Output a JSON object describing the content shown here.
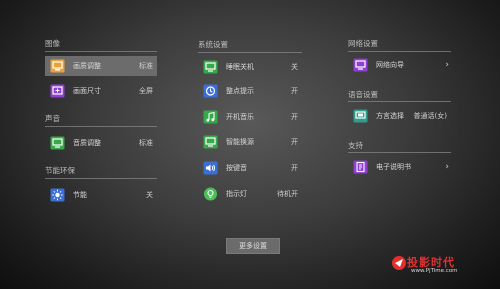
{
  "columns": {
    "left": {
      "picture": {
        "title": "图像",
        "items": [
          {
            "label": "画质调整",
            "value": "标准",
            "icon": "picture-adjust-icon",
            "selected": true
          },
          {
            "label": "画面尺寸",
            "value": "全屏",
            "icon": "screen-size-icon"
          }
        ]
      },
      "sound": {
        "title": "声音",
        "items": [
          {
            "label": "音质调整",
            "value": "标准",
            "icon": "sound-quality-icon"
          }
        ]
      },
      "eco": {
        "title": "节能环保",
        "items": [
          {
            "label": "节能",
            "value": "关",
            "icon": "energy-saving-icon"
          }
        ]
      }
    },
    "middle": {
      "system": {
        "title": "系统设置",
        "items": [
          {
            "label": "睡眠关机",
            "value": "关",
            "icon": "sleep-shutdown-icon"
          },
          {
            "label": "整点提示",
            "value": "开",
            "icon": "hourly-reminder-icon"
          },
          {
            "label": "开机音乐",
            "value": "开",
            "icon": "boot-music-icon"
          },
          {
            "label": "智能换源",
            "value": "开",
            "icon": "smart-source-icon"
          },
          {
            "label": "按键音",
            "value": "开",
            "icon": "key-sound-icon"
          },
          {
            "label": "指示灯",
            "value": "待机开",
            "icon": "indicator-light-icon"
          }
        ]
      }
    },
    "right": {
      "network": {
        "title": "网络设置",
        "items": [
          {
            "label": "网络向导",
            "icon": "network-wizard-icon"
          }
        ]
      },
      "voice": {
        "title": "语音设置",
        "items": [
          {
            "label": "方言选择",
            "value": "普通话(女)",
            "icon": "dialect-icon"
          }
        ]
      },
      "support": {
        "title": "支持",
        "items": [
          {
            "label": "电子说明书",
            "icon": "e-manual-icon"
          }
        ]
      }
    }
  },
  "more_settings": "更多设置",
  "watermark": {
    "title": "投影时代",
    "url": "www.PjTime.com"
  },
  "colors": {
    "orange": "#e9a23b",
    "blue": "#3b6fd6",
    "green": "#38a94a",
    "purple": "#8f3fd2",
    "teal": "#2f9c8c",
    "indicator-green": "#4cbf5a"
  }
}
